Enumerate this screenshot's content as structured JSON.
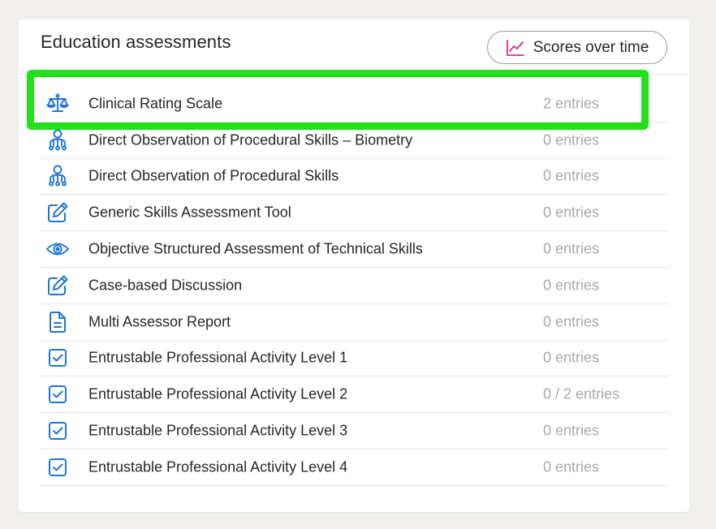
{
  "card": {
    "title": "Education assessments",
    "scores_button": {
      "label": "Scores over time",
      "icon": "line-chart-icon"
    }
  },
  "colors": {
    "icon_blue": "#1f76d2",
    "chart_icon_pink": "#d63384",
    "highlight_green": "#22e01a",
    "muted_text": "#a8a8a8"
  },
  "assessments": [
    {
      "label": "Clinical Rating Scale",
      "count": "2 entries",
      "icon": "scale-icon"
    },
    {
      "label": "Direct Observation of Procedural Skills – Biometry",
      "count": "0 entries",
      "icon": "person-network-icon"
    },
    {
      "label": "Direct Observation of Procedural Skills",
      "count": "0 entries",
      "icon": "person-network-icon"
    },
    {
      "label": "Generic Skills Assessment Tool",
      "count": "0 entries",
      "icon": "edit-icon"
    },
    {
      "label": "Objective Structured Assessment of Technical Skills",
      "count": "0 entries",
      "icon": "eye-icon"
    },
    {
      "label": "Case-based Discussion",
      "count": "0 entries",
      "icon": "edit-icon"
    },
    {
      "label": "Multi Assessor Report",
      "count": "0 entries",
      "icon": "document-icon"
    },
    {
      "label": "Entrustable Professional Activity Level 1",
      "count": "0 entries",
      "icon": "checkbox-icon"
    },
    {
      "label": "Entrustable Professional Activity Level 2",
      "count": "0 / 2 entries",
      "icon": "checkbox-icon"
    },
    {
      "label": "Entrustable Professional Activity Level 3",
      "count": "0 entries",
      "icon": "checkbox-icon"
    },
    {
      "label": "Entrustable Professional Activity Level 4",
      "count": "0 entries",
      "icon": "checkbox-icon"
    }
  ]
}
